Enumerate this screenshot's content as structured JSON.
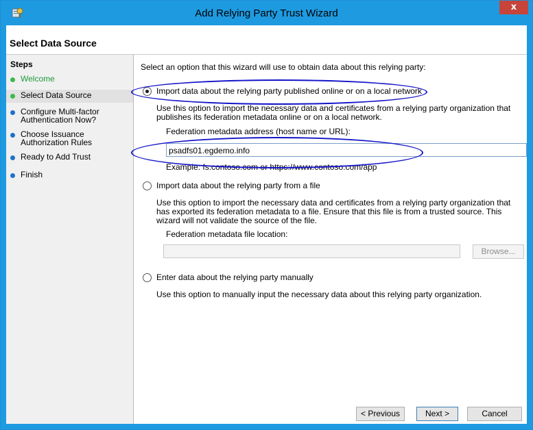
{
  "window": {
    "title": "Add Relying Party Trust Wizard",
    "close_glyph": "x"
  },
  "header": {
    "page_title": "Select Data Source"
  },
  "steps": {
    "title": "Steps",
    "items": [
      {
        "label": "Welcome",
        "status": "done"
      },
      {
        "label": "Select Data Source",
        "status": "current"
      },
      {
        "label": "Configure Multi-factor Authentication Now?",
        "status": "pending"
      },
      {
        "label": "Choose Issuance Authorization Rules",
        "status": "pending"
      },
      {
        "label": "Ready to Add Trust",
        "status": "pending"
      },
      {
        "label": "Finish",
        "status": "pending"
      }
    ]
  },
  "main": {
    "intro": "Select an option that this wizard will use to obtain data about this relying party:",
    "option_online": {
      "label": "Import data about the relying party published online or on a local network",
      "selected": true,
      "description": "Use this option to import the necessary data and certificates from a relying party organization that publishes its federation metadata online or on a local network.",
      "field_label": "Federation metadata address (host name or URL):",
      "field_value": "psadfs01.egdemo.info",
      "example": "Example: fs.contoso.com or https://www.contoso.com/app"
    },
    "option_file": {
      "label": "Import data about the relying party from a file",
      "selected": false,
      "description": "Use this option to import the necessary data and certificates from a relying party organization that has exported its federation metadata to a file. Ensure that this file is from a trusted source.  This wizard will not validate the source of the file.",
      "field_label": "Federation metadata file location:",
      "field_value": "",
      "browse_label": "Browse..."
    },
    "option_manual": {
      "label": "Enter data about the relying party manually",
      "selected": false,
      "description": "Use this option to manually input the necessary data about this relying party organization."
    }
  },
  "footer": {
    "previous_label": "< Previous",
    "next_label": "Next >",
    "cancel_label": "Cancel"
  },
  "colors": {
    "titlebar": "#1e9ae0",
    "close": "#c7443a",
    "step_done": "#3db84a",
    "step_pending": "#1e72c8",
    "step_link": "#1e9a3a",
    "annotation": "#1414c8"
  }
}
